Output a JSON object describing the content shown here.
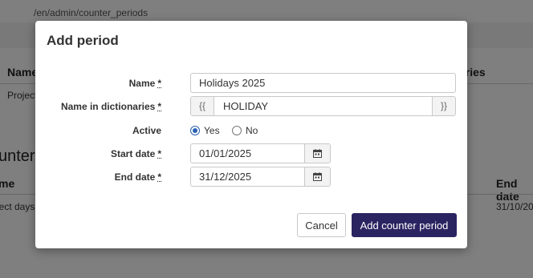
{
  "background": {
    "url": "/en/admin/counter_periods",
    "table1": {
      "header_name": "Name",
      "header_dictionaries": "aries",
      "row_name": "Project"
    },
    "section_title": "unter p",
    "table2": {
      "header_name": "me",
      "header_end_date": "End date",
      "row_name": "ject days",
      "row_end_date": "31/10/20"
    }
  },
  "modal": {
    "title": "Add period",
    "fields": {
      "name": {
        "label": "Name",
        "required_marker": "*",
        "value": "Holidays 2025"
      },
      "dictionary_name": {
        "label": "Name in dictionaries",
        "required_marker": "*",
        "prefix": "{{",
        "value": "HOLIDAY",
        "suffix": "}}"
      },
      "active": {
        "label": "Active",
        "options": [
          {
            "label": "Yes",
            "checked": true
          },
          {
            "label": "No",
            "checked": false
          }
        ]
      },
      "start_date": {
        "label": "Start date",
        "required_marker": "*",
        "value": "01/01/2025",
        "icon": "calendar-icon"
      },
      "end_date": {
        "label": "End date",
        "required_marker": "*",
        "value": "31/12/2025",
        "icon": "calendar-icon"
      }
    },
    "buttons": {
      "cancel": "Cancel",
      "submit": "Add counter period"
    }
  },
  "colors": {
    "primary_button": "#2a2461",
    "radio_accent": "#2a5fb0",
    "overlay": "rgba(0,0,0,0.5)"
  }
}
